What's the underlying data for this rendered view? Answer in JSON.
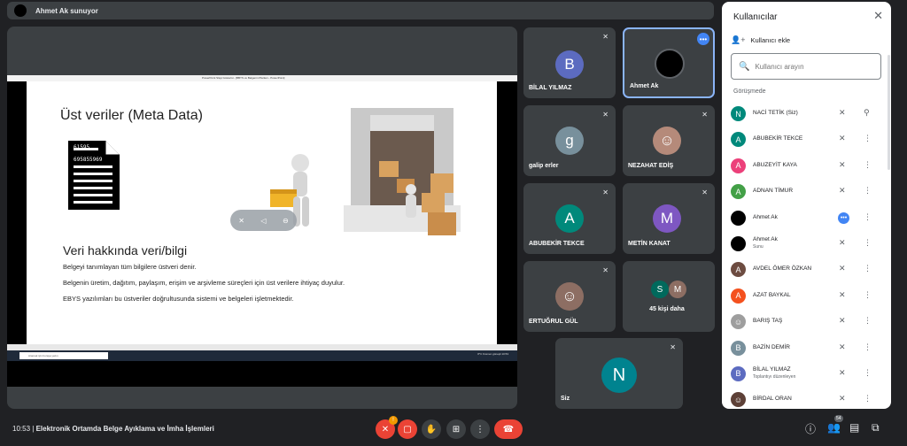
{
  "presenter": {
    "label": "Ahmet Ak sunuyor"
  },
  "slide": {
    "window_title": "PowerPoint Slayt Gösterisi - [BBYS ve Belgenin Planları - PowerPoint]",
    "title": "Üst veriler (Meta Data)",
    "subtitle": "Veri hakkında veri/bilgi",
    "line1": "Belgeyi tanımlayan tüm bilgilere üstveri denir.",
    "line2": "Belgenin üretim, dağıtım, paylaşım, erişim ve arşivleme süreçleri için üst verilere ihtiyaç duyulur.",
    "line3": "EBYS yazılımları bu üstveriler doğrultusunda sistemi ve belgeleri işletmektedir.",
    "doc_num1": "61595",
    "doc_num2": "695855969",
    "taskbar_search": "Aramak için buraya yazın",
    "tray": "8°C  Kısmen güneşli   10:53"
  },
  "tiles": [
    {
      "name": "BİLAL YILMAZ",
      "initial": "B",
      "color": "#5c6bc0"
    },
    {
      "name": "Ahmet Ak"
    },
    {
      "name": "galip erler",
      "initial": "g",
      "color": "#78909c"
    },
    {
      "name": "NEZAHAT EDİŞ"
    },
    {
      "name": "ABUBEKİR TEKCE",
      "initial": "A",
      "color": "#00897b"
    },
    {
      "name": "METİN KANAT",
      "initial": "M",
      "color": "#7e57c2"
    },
    {
      "name": "ERTUĞRUL GÜL"
    },
    {
      "name": "45 kişi daha",
      "i1": "S",
      "i2": "M"
    },
    {
      "name": "Siz",
      "initial": "N",
      "color": "#00838f"
    }
  ],
  "meeting": {
    "time": "10:53",
    "title": "Elektronik Ortamda Belge Ayıklama ve İmha İşlemleri",
    "people_count": "54"
  },
  "panel": {
    "title": "Kullanıcılar",
    "add_label": "Kullanıcı ekle",
    "search_placeholder": "Kullanıcı arayın",
    "section": "Görüşmede",
    "people": [
      {
        "name": "NACİ TETİK (Siz)",
        "initial": "N",
        "color": "#00897b"
      },
      {
        "name": "ABUBEKİR TEKCE",
        "initial": "A",
        "color": "#00897b"
      },
      {
        "name": "ABUZEYİT KAYA",
        "initial": "A",
        "color": "#ec407a"
      },
      {
        "name": "ADNAN TİMUR",
        "initial": "A",
        "color": "#43a047"
      },
      {
        "name": "Ahmet Ak",
        "initial": "",
        "color": "#000000"
      },
      {
        "name": "Ahmet Ak",
        "sub": "Sunu",
        "initial": "",
        "color": "#000000"
      },
      {
        "name": "AVDEL ÖMER ÖZKAN",
        "initial": "A",
        "color": "#6d4c41"
      },
      {
        "name": "AZAT BAYKAL",
        "initial": "A",
        "color": "#f4511e"
      },
      {
        "name": "BARIŞ TAŞ",
        "initial": "",
        "color": "#9e9e9e"
      },
      {
        "name": "BAZİN DEMİR",
        "initial": "B",
        "color": "#78909c"
      },
      {
        "name": "BİLAL YILMAZ",
        "sub": "Toplantıyı düzenleyen",
        "initial": "B",
        "color": "#5c6bc0"
      },
      {
        "name": "BİRDAL ORAN",
        "initial": "",
        "color": "#5d4037"
      }
    ]
  }
}
